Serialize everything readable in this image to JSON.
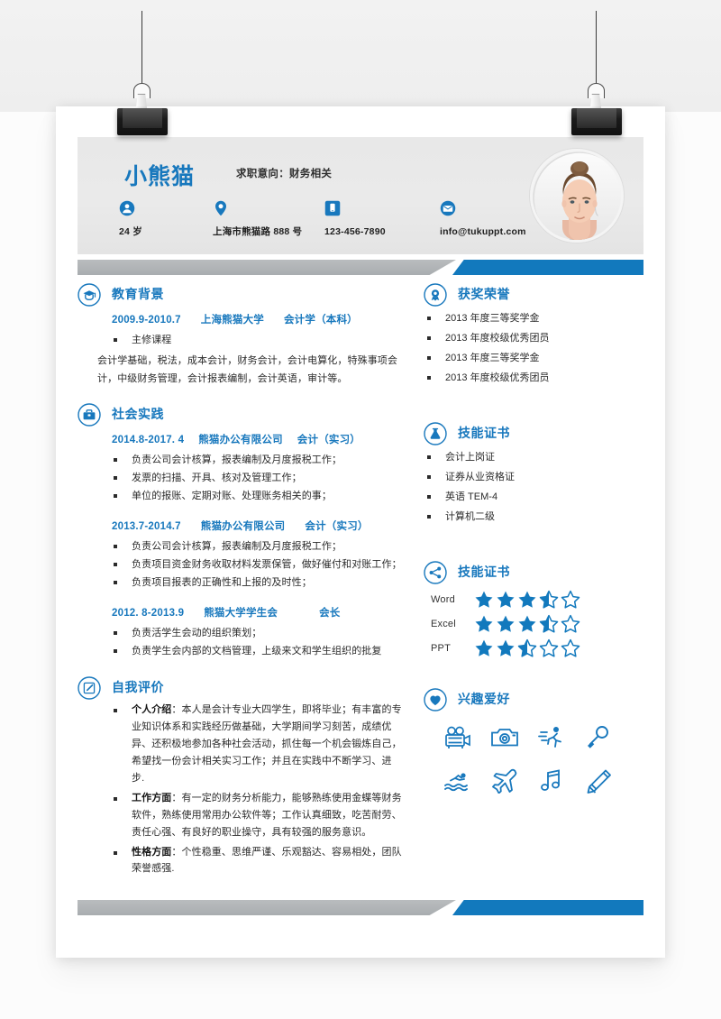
{
  "theme": {
    "accent": "#1878bd",
    "accent_bar": "#1279bd",
    "gray_bar": "#b0b4b7",
    "text": "#2b2b2b"
  },
  "header": {
    "name": "小熊猫",
    "objective": "求职意向：财务相关",
    "contacts": [
      {
        "icon": "person-icon",
        "value": "24 岁"
      },
      {
        "icon": "location-pin-icon",
        "value": "上海市熊猫路 888 号"
      },
      {
        "icon": "phone-icon",
        "value": "123-456-7890"
      },
      {
        "icon": "envelope-icon",
        "value": "info@tukuppt.com"
      }
    ],
    "photo_alt": "头像"
  },
  "left_column": {
    "education": {
      "icon": "graduation-cap-icon",
      "title": "教育背景",
      "entry": {
        "date": "2009.9-2010.7",
        "school": "上海熊猫大学",
        "degree": "会计学（本科）"
      },
      "bullets": [
        "主修课程"
      ],
      "paragraph": "会计学基础，税法，成本会计，财务会计，会计电算化，特殊事项会计，中级财务管理，会计报表编制，会计英语，审计等。"
    },
    "practice": {
      "icon": "briefcase-icon",
      "title": "社会实践",
      "entries": [
        {
          "date": "2014.8-2017. 4",
          "org": "熊猫办公有限公司",
          "role": "会计（实习）",
          "bullets": [
            "负责公司会计核算，报表编制及月度报税工作；",
            "发票的扫描、开具、核对及管理工作；",
            "单位的报账、定期对账、处理账务相关的事；"
          ]
        },
        {
          "date": "2013.7-2014.7",
          "org": "熊猫办公有限公司",
          "role": "会计（实习）",
          "bullets": [
            "负责公司会计核算，报表编制及月度报税工作；",
            "负责项目资金财务收取材料发票保管，做好催付和对账工作；",
            "负责项目报表的正确性和上报的及时性；"
          ]
        },
        {
          "date": "2012. 8-2013.9",
          "org": "熊猫大学学生会",
          "role": "会长",
          "bullets": [
            "负责活学生会动的组织策划；",
            "负责学生会内部的文档管理，上级来文和学生组织的批复"
          ]
        }
      ]
    },
    "self_eval": {
      "icon": "edit-pencil-icon",
      "title": "自我评价",
      "items": [
        {
          "label": "个人介绍",
          "text": "：本人是会计专业大四学生，即将毕业；有丰富的专业知识体系和实践经历做基础，大学期间学习刻苦，成绩优异、还积极地参加各种社会活动，抓住每一个机会锻炼自己，希望找一份会计相关实习工作；并且在实践中不断学习、进步."
        },
        {
          "label": "工作方面",
          "text": "：有一定的财务分析能力，能够熟练使用金蝶等财务软件，熟练使用常用办公软件等；工作认真细致，吃苦耐劳、责任心强、有良好的职业操守，具有较强的服务意识。"
        },
        {
          "label": "性格方面",
          "text": "：个性稳重、思维严谨、乐观豁达、容易相处，团队荣誉感强."
        }
      ]
    }
  },
  "right_column": {
    "awards": {
      "icon": "award-medal-icon",
      "title": "获奖荣誉",
      "items": [
        "2013 年度三等奖学金",
        "2013 年度校级优秀团员",
        "2013 年度三等奖学金",
        "2013 年度校级优秀团员"
      ]
    },
    "certificates": {
      "icon": "flask-icon",
      "title": "技能证书",
      "items": [
        "会计上岗证",
        "证券从业资格证",
        "英语 TEM-4",
        "计算机二级"
      ]
    },
    "skills": {
      "icon": "share-nodes-icon",
      "title": "技能证书",
      "max_stars": 5,
      "items": [
        {
          "name": "Word",
          "rating": 3.5
        },
        {
          "name": "Excel",
          "rating": 3.5
        },
        {
          "name": "PPT",
          "rating": 2.5
        }
      ]
    },
    "hobbies": {
      "icon": "heart-icon",
      "title": "兴趣爱好",
      "items": [
        "film-camera-icon",
        "photo-camera-icon",
        "running-icon",
        "microphone-icon",
        "swimming-icon",
        "airplane-icon",
        "music-note-icon",
        "pencil-icon"
      ]
    }
  }
}
